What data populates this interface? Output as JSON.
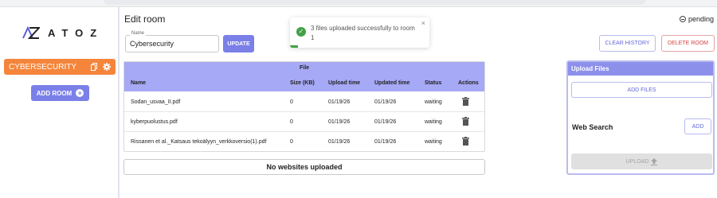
{
  "app": {
    "logo_text": "ATOZ",
    "page_title": "Edit room",
    "status_text": "pending"
  },
  "sidebar": {
    "rooms": [
      {
        "label": "CYBERSECURITY"
      }
    ],
    "add_room_label": "ADD ROOM"
  },
  "room_form": {
    "name_label": "Name",
    "name_value": "Cybersecurity",
    "update_label": "UPDATE"
  },
  "actions": {
    "clear_history_label": "CLEAR HISTORY",
    "delete_room_label": "DELETE ROOM"
  },
  "toast": {
    "message": "3 files uploaded successfully to room 1",
    "close_glyph": "×"
  },
  "files_table": {
    "group_header": "File",
    "columns": [
      "Name",
      "Size (KB)",
      "Upload time",
      "Updated time",
      "Status",
      "Actions"
    ],
    "rows": [
      {
        "name": "Sodan_usvaa_II.pdf",
        "size": "0",
        "upload_time": "01/19/26",
        "updated_time": "01/19/26",
        "status": "waiting"
      },
      {
        "name": "kyberpuolustus.pdf",
        "size": "0",
        "upload_time": "01/19/26",
        "updated_time": "01/19/26",
        "status": "waiting"
      },
      {
        "name": "Rissanen et al._Katsaus tekoälyyn_verkkoversio(1).pdf",
        "size": "0",
        "upload_time": "01/19/26",
        "updated_time": "01/19/26",
        "status": "waiting"
      }
    ]
  },
  "websites": {
    "empty_text": "No websites uploaded"
  },
  "upload_panel": {
    "title": "Upload Files",
    "add_files_label": "ADD FILES",
    "web_search_label": "Web Search",
    "add_label": "ADD",
    "upload_label": "UPLOAD"
  },
  "colors": {
    "accent": "#7b7fe8",
    "room_active": "#f4853b",
    "table_header": "#a6a9f5",
    "success": "#43a047",
    "danger": "#d24444"
  }
}
